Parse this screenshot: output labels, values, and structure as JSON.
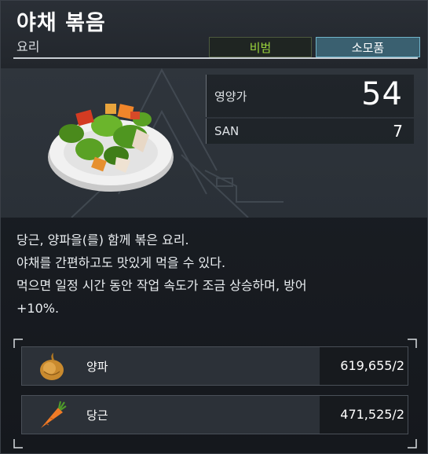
{
  "item": {
    "name": "야채 볶음",
    "category": "요리",
    "tags": {
      "secret": "비범",
      "consumable": "소모품"
    },
    "stats": {
      "nutrition_label": "영양가",
      "nutrition_value": "54",
      "san_label": "SAN",
      "san_value": "7"
    },
    "description": [
      "당근, 양파을(를) 함께 볶은 요리.",
      "야채를 간편하고도 맛있게 먹을 수 있다.",
      "먹으면 일정 시간 동안 작업 속도가 조금 상승하며, 방어",
      "+10%."
    ],
    "ingredients": [
      {
        "name": "양파",
        "quantity": "619,655/2",
        "icon": "onion-icon"
      },
      {
        "name": "당근",
        "quantity": "471,525/2",
        "icon": "carrot-icon"
      }
    ]
  },
  "colors": {
    "secret_tag": "#9ad43c",
    "consumable_tag_bg": "#3a6070",
    "consumable_tag_border": "#6fb3c9"
  }
}
